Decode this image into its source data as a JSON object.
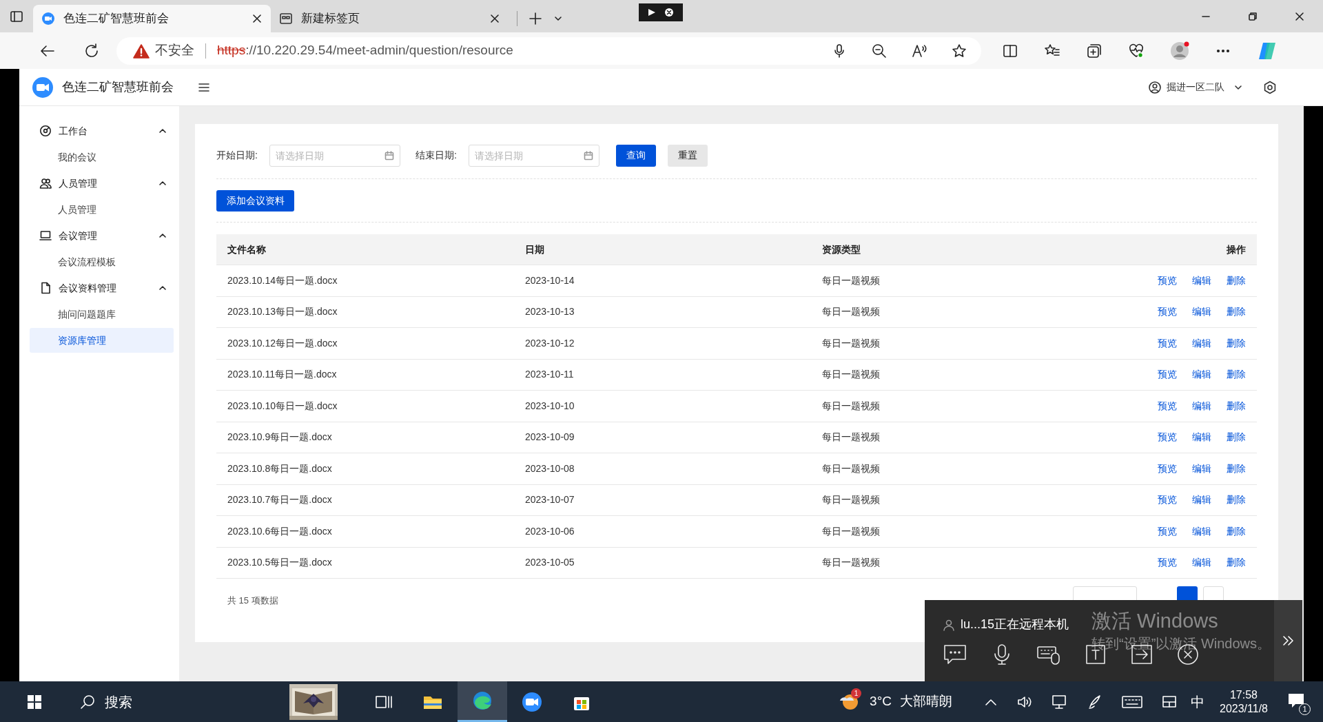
{
  "browser": {
    "tabs": [
      {
        "title": "色连二矿智慧班前会",
        "selected": true
      },
      {
        "title": "新建标签页",
        "selected": false
      }
    ],
    "security": "不安全",
    "url_scheme": "https",
    "url_rest": "://10.220.29.54/meet-admin/question/resource"
  },
  "app": {
    "title": "色连二矿智慧班前会",
    "user": "掘进一区二队"
  },
  "sidebar": {
    "groups": [
      {
        "label": "工作台",
        "expanded": true,
        "items": [
          {
            "label": "我的会议",
            "selected": false
          }
        ]
      },
      {
        "label": "人员管理",
        "expanded": true,
        "items": [
          {
            "label": "人员管理",
            "selected": false
          }
        ]
      },
      {
        "label": "会议管理",
        "expanded": true,
        "items": [
          {
            "label": "会议流程模板",
            "selected": false
          }
        ]
      },
      {
        "label": "会议资料管理",
        "expanded": true,
        "items": [
          {
            "label": "抽问问题题库",
            "selected": false
          },
          {
            "label": "资源库管理",
            "selected": true
          }
        ]
      }
    ]
  },
  "filters": [
    {
      "label": "开始日期:",
      "placeholder": "请选择日期"
    },
    {
      "label": "结束日期:",
      "placeholder": "请选择日期"
    }
  ],
  "buttons": {
    "query": "查询",
    "reset": "重置",
    "add": "添加会议资料"
  },
  "table": {
    "columns": [
      "文件名称",
      "日期",
      "资源类型",
      "操作"
    ],
    "rows": [
      {
        "name": "2023.10.14每日一题.docx",
        "date": "2023-10-14",
        "type": "每日一题视频",
        "actions": [
          "预览",
          "编辑",
          "删除"
        ]
      },
      {
        "name": "2023.10.13每日一题.docx",
        "date": "2023-10-13",
        "type": "每日一题视频",
        "actions": [
          "预览",
          "编辑",
          "删除"
        ]
      },
      {
        "name": "2023.10.12每日一题.docx",
        "date": "2023-10-12",
        "type": "每日一题视频",
        "actions": [
          "预览",
          "编辑",
          "删除"
        ]
      },
      {
        "name": "2023.10.11每日一题.docx",
        "date": "2023-10-11",
        "type": "每日一题视频",
        "actions": [
          "预览",
          "编辑",
          "删除"
        ]
      },
      {
        "name": "2023.10.10每日一题.docx",
        "date": "2023-10-10",
        "type": "每日一题视频",
        "actions": [
          "预览",
          "编辑",
          "删除"
        ]
      },
      {
        "name": "2023.10.9每日一题.docx",
        "date": "2023-10-09",
        "type": "每日一题视频",
        "actions": [
          "预览",
          "编辑",
          "删除"
        ]
      },
      {
        "name": "2023.10.8每日一题.docx",
        "date": "2023-10-08",
        "type": "每日一题视频",
        "actions": [
          "预览",
          "编辑",
          "删除"
        ]
      },
      {
        "name": "2023.10.7每日一题.docx",
        "date": "2023-10-07",
        "type": "每日一题视频",
        "actions": [
          "预览",
          "编辑",
          "删除"
        ]
      },
      {
        "name": "2023.10.6每日一题.docx",
        "date": "2023-10-06",
        "type": "每日一题视频",
        "actions": [
          "预览",
          "编辑",
          "删除"
        ]
      },
      {
        "name": "2023.10.5每日一题.docx",
        "date": "2023-10-05",
        "type": "每日一题视频",
        "actions": [
          "预览",
          "编辑",
          "删除"
        ]
      }
    ]
  },
  "total": "共 15 项数据",
  "pagination": {
    "pages": [
      {
        "selected": true
      },
      {
        "selected": false
      }
    ]
  },
  "remote": {
    "status": "lu...15正在远程本机"
  },
  "watermark": {
    "title": "激活 Windows",
    "hint": "转到“设置”以激活 Windows。"
  },
  "taskbar": {
    "search": "搜索",
    "weather_badge": "1",
    "temperature": "3°C",
    "weather": "大部晴朗",
    "ime": "中",
    "time": "17:58",
    "date": "2023/11/8",
    "notifications": "1"
  }
}
